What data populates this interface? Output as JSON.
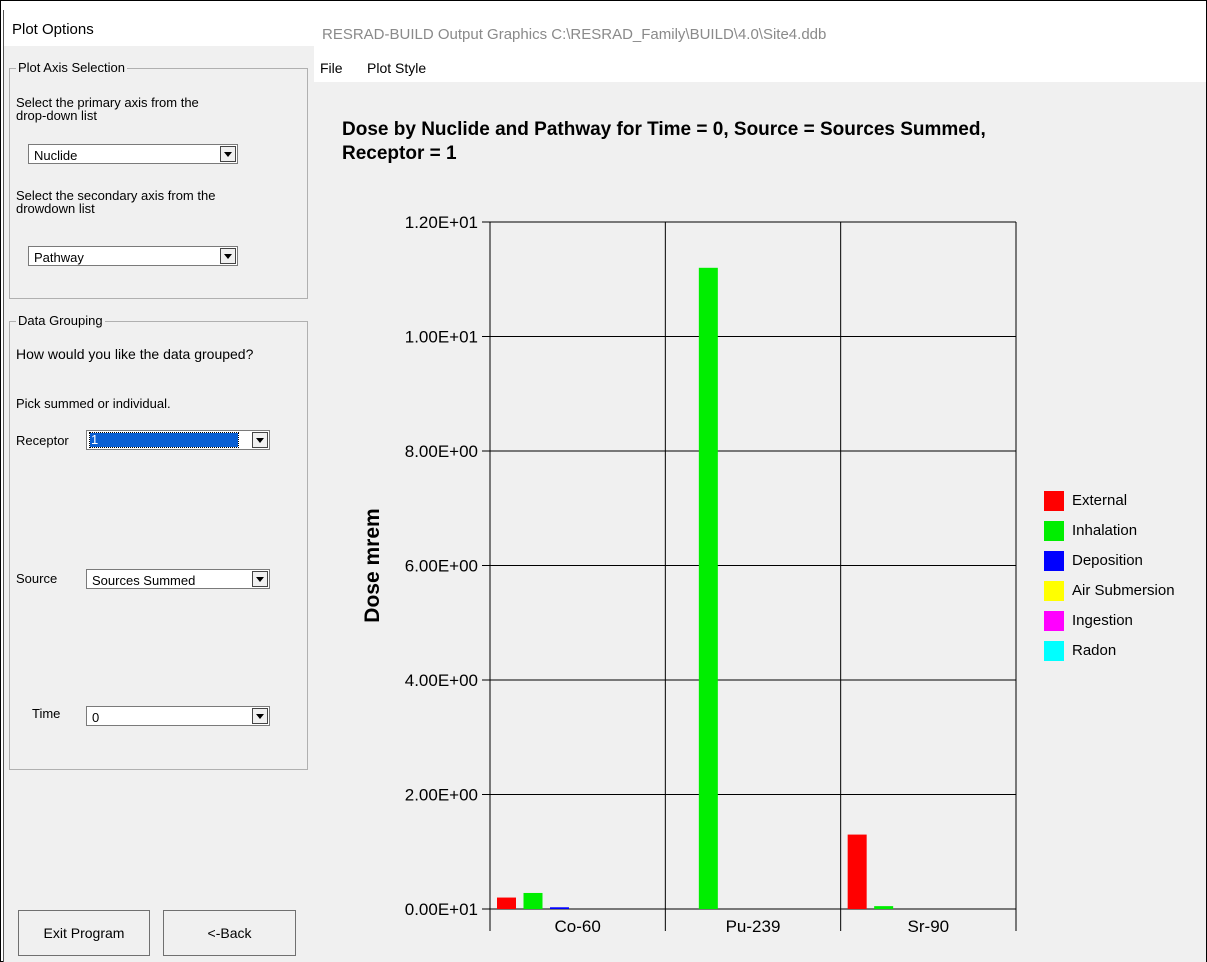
{
  "left_panel": {
    "title": "Plot Options",
    "axis_group": {
      "legend": "Plot Axis Selection",
      "primary_prompt_line1": "Select the primary axis from the",
      "primary_prompt_line2": "drop-down list",
      "primary_value": "Nuclide",
      "secondary_prompt_line1": "Select the secondary axis from the",
      "secondary_prompt_line2": "drowdown list",
      "secondary_value": "Pathway"
    },
    "grouping_group": {
      "legend": "Data Grouping",
      "question": "How would you like the data grouped?",
      "instruction": "Pick summed or individual.",
      "receptor_label": "Receptor",
      "receptor_value": "1",
      "source_label": "Source",
      "source_value": "Sources Summed",
      "time_label": "Time",
      "time_value": "0"
    },
    "buttons": {
      "exit": "Exit Program",
      "back": "<-Back"
    }
  },
  "window": {
    "title": "RESRAD-BUILD Output Graphics C:\\RESRAD_Family\\BUILD\\4.0\\Site4.ddb",
    "menu": [
      "File",
      "Plot Style"
    ]
  },
  "chart_data": {
    "type": "bar",
    "title_line1": "Dose by Nuclide and Pathway for Time = 0, Source = Sources Summed,",
    "title_line2": "Receptor = 1",
    "ylabel": "Dose mrem",
    "xlabel": "",
    "categories": [
      "Co-60",
      "Pu-239",
      "Sr-90"
    ],
    "ylim": [
      0,
      12
    ],
    "yticks": [
      0,
      2,
      4,
      6,
      8,
      10,
      12
    ],
    "ytick_labels": [
      "0.00E+01",
      "2.00E+00",
      "4.00E+00",
      "6.00E+00",
      "8.00E+00",
      "1.00E+01",
      "1.20E+01"
    ],
    "grid": true,
    "legend_position": "right",
    "series": [
      {
        "name": "External",
        "color": "#ff0000",
        "values": [
          0.2,
          0,
          1.3
        ]
      },
      {
        "name": "Inhalation",
        "color": "#00ee00",
        "values": [
          0.28,
          11.2,
          0.05
        ]
      },
      {
        "name": "Deposition",
        "color": "#0000ff",
        "values": [
          0.03,
          0,
          0
        ]
      },
      {
        "name": "Air Submersion",
        "color": "#ffff00",
        "values": [
          0,
          0,
          0
        ]
      },
      {
        "name": "Ingestion",
        "color": "#ff00ff",
        "values": [
          0,
          0,
          0
        ]
      },
      {
        "name": "Radon",
        "color": "#00ffff",
        "values": [
          0,
          0,
          0
        ]
      }
    ]
  }
}
